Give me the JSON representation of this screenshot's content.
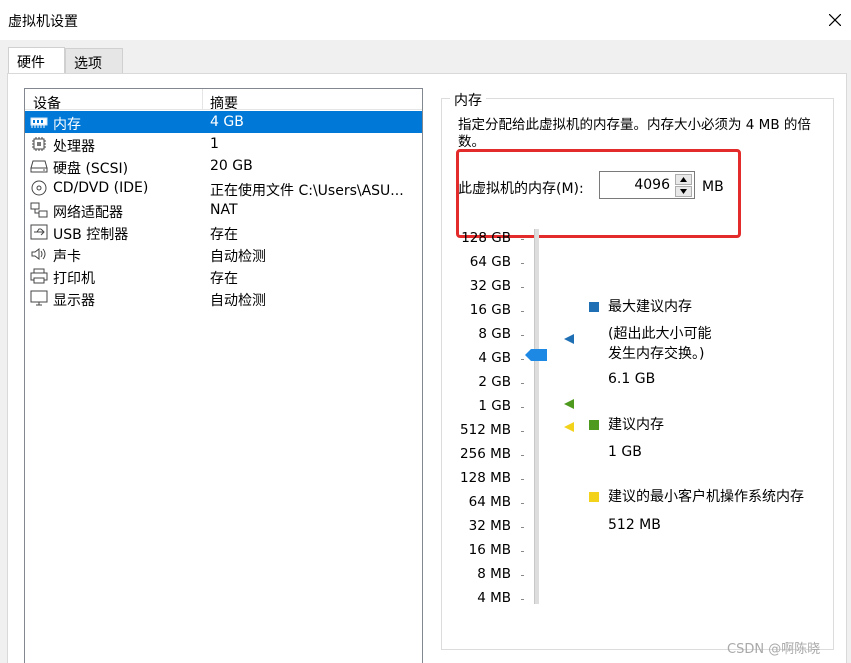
{
  "window": {
    "title": "虚拟机设置"
  },
  "tabs": [
    {
      "label": "硬件",
      "active": true
    },
    {
      "label": "选项",
      "active": false
    }
  ],
  "device_list": {
    "columns": [
      "设备",
      "摘要"
    ],
    "rows": [
      {
        "icon": "memory-icon",
        "name": "内存",
        "summary": "4 GB",
        "selected": true
      },
      {
        "icon": "processor-icon",
        "name": "处理器",
        "summary": "1",
        "selected": false
      },
      {
        "icon": "hard-disk-icon",
        "name": "硬盘 (SCSI)",
        "summary": "20 GB",
        "selected": false
      },
      {
        "icon": "cd-dvd-icon",
        "name": "CD/DVD (IDE)",
        "summary": "正在使用文件 C:\\Users\\ASU...",
        "selected": false
      },
      {
        "icon": "network-adapter-icon",
        "name": "网络适配器",
        "summary": "NAT",
        "selected": false
      },
      {
        "icon": "usb-icon",
        "name": "USB 控制器",
        "summary": "存在",
        "selected": false
      },
      {
        "icon": "sound-card-icon",
        "name": "声卡",
        "summary": "自动检测",
        "selected": false
      },
      {
        "icon": "printer-icon",
        "name": "打印机",
        "summary": "存在",
        "selected": false
      },
      {
        "icon": "display-icon",
        "name": "显示器",
        "summary": "自动检测",
        "selected": false
      }
    ]
  },
  "memory": {
    "group_title": "内存",
    "description": "指定分配给此虚拟机的内存量。内存大小必须为 4 MB 的倍数。",
    "field_label": "此虚拟机的内存(M):",
    "value": "4096",
    "unit": "MB",
    "scale_labels": [
      "128 GB",
      "64 GB",
      "32 GB",
      "16 GB",
      "8 GB",
      "4 GB",
      "2 GB",
      "1 GB",
      "512 MB",
      "256 MB",
      "128 MB",
      "64 MB",
      "32 MB",
      "16 MB",
      "8 MB",
      "4 MB"
    ],
    "legend": {
      "max": {
        "title": "最大建议内存",
        "note1": "(超出此大小可能",
        "note2": "发生内存交换。)",
        "value": "6.1 GB",
        "color": "#1f6fb5"
      },
      "recommended": {
        "title": "建议内存",
        "value": "1 GB",
        "color": "#4d9a1e"
      },
      "min_guest": {
        "title": "建议的最小客户机操作系统内存",
        "value": "512 MB",
        "color": "#f2d21b"
      }
    },
    "thumb_color": "#1e88e5"
  },
  "watermark": "CSDN @啊陈晓"
}
